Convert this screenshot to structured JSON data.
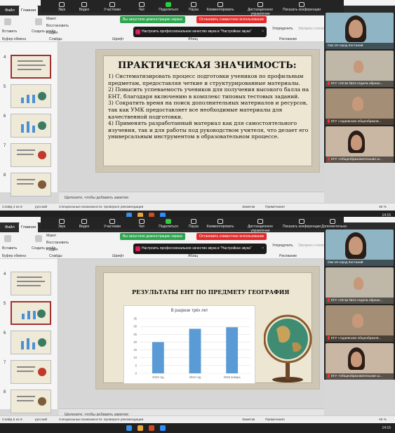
{
  "zoom": {
    "buttons": [
      "Звук",
      "Видео",
      "Участники",
      "Чат",
      "Поделиться",
      "Пауза",
      "Комментировать",
      "Дистанционное управление",
      "Показать конференции",
      "Дополнительно"
    ],
    "share_banner": "Вы запустили демонстрацию экрана",
    "stop_label": "Остановить совместное использование",
    "tip_text": "Настроить профессиональное качество звука в \"Настройках звука\"",
    "participants": [
      {
        "name": "ОШ 19 город Костанай",
        "muted": false
      },
      {
        "name": "КГУ «ОСШ №13 отдела образо...",
        "muted": true
      },
      {
        "name": "КГУ «Адаевская общеобразов...",
        "muted": true
      },
      {
        "name": "КГУ «Общеобразовательная ш...",
        "muted": true
      }
    ]
  },
  "ribbon": {
    "tabs": [
      "Файл",
      "Главная"
    ],
    "insert_label": "Вставить",
    "create_slide_label": "Создать слайд",
    "layout_label": "Макет",
    "reset_label": "Восстановить",
    "section_label": "Раздел",
    "clipboard_group": "Буфер обмена",
    "slides_group": "Слайды",
    "font_group": "Шрифт",
    "paragraph_group": "Абзац",
    "drawing_group": "Рисование",
    "arrange_label": "Упорядочить",
    "express_label": "Экспресс-стили"
  },
  "windows": [
    {
      "thumbs": [
        "4",
        "5",
        "6",
        "7",
        "8"
      ],
      "selected_thumb": 0,
      "slide": {
        "title": "ПРАКТИЧЕСКАЯ ЗНАЧИМОСТЬ:",
        "body": "1) Систематизировать процесс подготовки учеников по профильным предметам, предоставляя четкие и структурированные материалы.\n2) Повысить успеваемость учеников для получения высокого балла на ЕНТ, благодаря включению в комплекс типовых тестовых заданий.\n3) Сократить время на поиск дополнительных материалов и ресурсов, так как УМК предоставляет все необходимые материалы для качественной подготовки.\n4) Применять разработанный материал как для самостоятельного изучения, так и для работы под руководством учителя, что делает его универсальным инструментом в образовательном процессе."
      },
      "notes": "Щелкните, чтобы добавить заметки",
      "status": {
        "slide": "Слайд 4 из 8",
        "lang": "русский",
        "access": "Специальные возможности: проверьте рекомендации",
        "notes": "Заметки",
        "comments": "Примечания",
        "zoom": "46 %"
      },
      "clock": "14:15"
    },
    {
      "thumbs": [
        "4",
        "5",
        "6",
        "7",
        "8"
      ],
      "selected_thumb": 1,
      "slide": {
        "title": "РЕЗУЛЬТАТЫ ЕНТ ПО ПРЕДМЕТУ ГЕОГРАФИЯ",
        "body": ""
      },
      "notes": "Щелкните, чтобы добавить заметки",
      "status": {
        "slide": "Слайд 5 из 8",
        "lang": "русский",
        "access": "Специальные возможности: проверьте рекомендации",
        "notes": "Заметки",
        "comments": "Примечания",
        "zoom": "46 %"
      },
      "clock": "14:15"
    }
  ],
  "chart_data": {
    "type": "bar",
    "title": "В разрезе трёх лет",
    "categories": [
      "2023 год",
      "2024 год",
      "2025 январь"
    ],
    "values": [
      20,
      28.5,
      29.5
    ],
    "ylim": [
      0,
      35
    ],
    "yticks": [
      0,
      5,
      10,
      15,
      20,
      25,
      30,
      35
    ],
    "color": "#5b9bd5",
    "grid": true
  }
}
